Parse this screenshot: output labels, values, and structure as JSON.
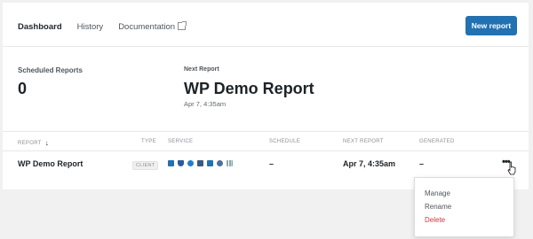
{
  "nav": {
    "items": [
      "Dashboard",
      "History",
      "Documentation"
    ],
    "active": "Dashboard"
  },
  "toolbar": {
    "new_report_label": "New report"
  },
  "stats": {
    "scheduled_label": "Scheduled Reports",
    "scheduled_value": "0",
    "next_label": "Next Report",
    "next_name": "WP Demo Report",
    "next_time": "Apr 7, 4:35am"
  },
  "table": {
    "headers": [
      "REPORT",
      "TYPE",
      "SERVICE",
      "SCHEDULE",
      "NEXT REPORT",
      "GENERATED"
    ],
    "rows": [
      {
        "report": "WP Demo Report",
        "type": "CLIENT",
        "services": [
          "download-icon",
          "shield-icon",
          "speed-icon",
          "server-icon",
          "backup-icon",
          "globe-icon",
          "chart-icon"
        ],
        "schedule": "–",
        "next_report": "Apr 7, 4:35am",
        "generated": "–",
        "actions": "•••"
      }
    ]
  },
  "context_menu": {
    "items": [
      "Manage",
      "Rename",
      "Delete"
    ]
  },
  "colors": {
    "accent": "#2271b1",
    "danger": "#d63638"
  }
}
